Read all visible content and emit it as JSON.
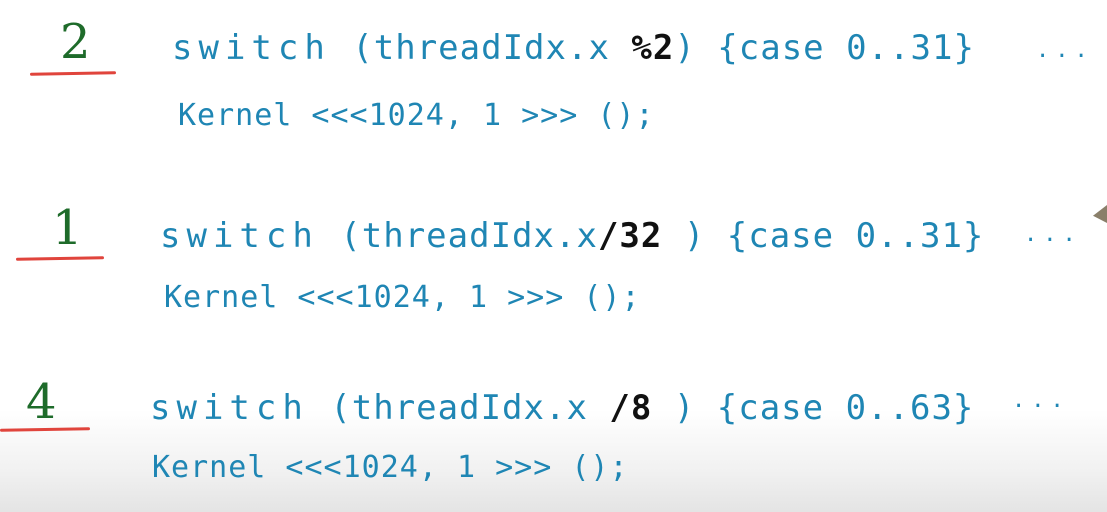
{
  "rows": [
    {
      "answer": "2",
      "line1": {
        "kw": "switch",
        "pre": " (threadIdx.x ",
        "dark": "%2",
        "post": ") {case 0..31}"
      },
      "line2": "Kernel <<<1024, 1 >>> ();",
      "dots": "..."
    },
    {
      "answer": "1",
      "line1": {
        "kw": "switch",
        "pre": " (threadIdx.x",
        "dark": "/32",
        "post": " ) {case 0..31}"
      },
      "line2": "Kernel <<<1024, 1 >>> ();",
      "dots": "..."
    },
    {
      "answer": "4",
      "line1": {
        "kw": "switch",
        "pre": " (threadIdx.x ",
        "dark": "/8",
        "post": " ) {case 0..63}"
      },
      "line2": "Kernel <<<1024, 1 >>> ();",
      "dots": "..."
    }
  ],
  "colors": {
    "code": "#1f86b4",
    "answer": "#1e6b2a",
    "underline": "#e0443c",
    "emphasis": "#111111"
  }
}
